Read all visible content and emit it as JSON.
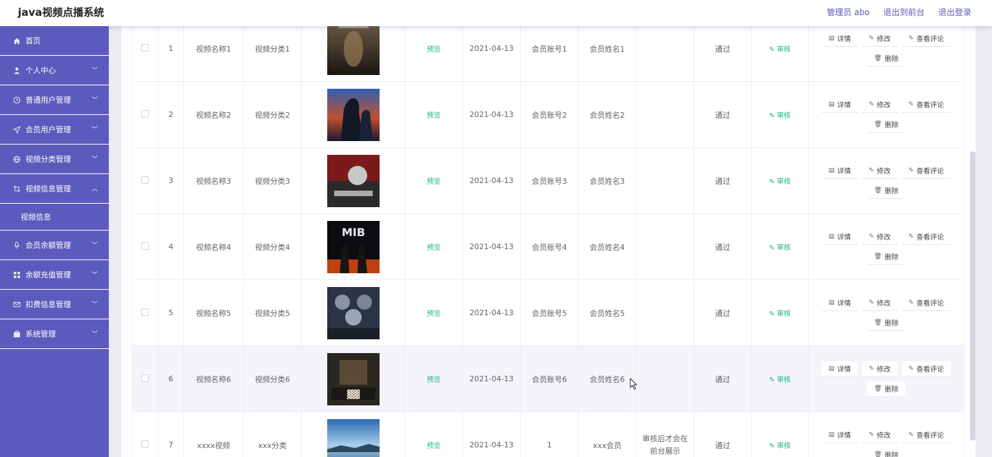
{
  "header": {
    "title": "java视频点播系统",
    "admin_label": "管理员 abo",
    "to_front_label": "退出到前台",
    "logout_label": "退出登录"
  },
  "sidebar": {
    "items": [
      {
        "label": "首页",
        "icon": "home-icon",
        "expandable": false
      },
      {
        "label": "个人中心",
        "icon": "user-icon",
        "expandable": true
      },
      {
        "label": "普通用户管理",
        "icon": "clock-icon",
        "expandable": true
      },
      {
        "label": "会员用户管理",
        "icon": "send-icon",
        "expandable": true
      },
      {
        "label": "视频分类管理",
        "icon": "globe-icon",
        "expandable": true
      },
      {
        "label": "视频信息管理",
        "icon": "crop-icon",
        "expandable": true,
        "expanded": true,
        "children": [
          "视频信息"
        ]
      },
      {
        "label": "会员余额管理",
        "icon": "mic-icon",
        "expandable": true
      },
      {
        "label": "余额充值管理",
        "icon": "grid-icon",
        "expandable": true
      },
      {
        "label": "扣费信息管理",
        "icon": "mail-icon",
        "expandable": true
      },
      {
        "label": "系统管理",
        "icon": "briefcase-icon",
        "expandable": true
      }
    ]
  },
  "table": {
    "preview_label": "预览",
    "audit_label": "审核",
    "actions": {
      "detail": "详情",
      "edit": "修改",
      "comments": "查看评论",
      "delete": "删除"
    },
    "rows": [
      {
        "index": "1",
        "name": "视频名称1",
        "category": "视频分类1",
        "date": "2021-04-13",
        "account": "会员账号1",
        "member_name": "会员姓名1",
        "reply": "",
        "status": "通过",
        "poster": "poster-titanic"
      },
      {
        "index": "2",
        "name": "视频名称2",
        "category": "视频分类2",
        "date": "2021-04-13",
        "account": "会员账号2",
        "member_name": "会员姓名2",
        "reply": "",
        "status": "通过",
        "poster": "poster-silhouette"
      },
      {
        "index": "3",
        "name": "视频名称3",
        "category": "视频分类3",
        "date": "2021-04-13",
        "account": "会员账号3",
        "member_name": "会员姓名3",
        "reply": "",
        "status": "通过",
        "poster": "poster-red"
      },
      {
        "index": "4",
        "name": "视频名称4",
        "category": "视频分类4",
        "date": "2021-04-13",
        "account": "会员账号4",
        "member_name": "会员姓名4",
        "reply": "",
        "status": "通过",
        "poster": "poster-mib"
      },
      {
        "index": "5",
        "name": "视频名称5",
        "category": "视频分类5",
        "date": "2021-04-13",
        "account": "会员账号5",
        "member_name": "会员姓名5",
        "reply": "",
        "status": "通过",
        "poster": "poster-blue"
      },
      {
        "index": "6",
        "name": "视频名称6",
        "category": "视频分类6",
        "date": "2021-04-13",
        "account": "会员账号6",
        "member_name": "会员姓名6",
        "reply": "",
        "status": "通过",
        "poster": "poster-war"
      },
      {
        "index": "7",
        "name": "xxxx视频",
        "category": "xxx分类",
        "date": "2021-04-13",
        "account": "1",
        "member_name": "xxx会员",
        "reply": "审核后才会在前台展示",
        "status": "通过",
        "poster": "poster-sky"
      }
    ]
  },
  "colors": {
    "sidebar_bg": "#5b5bbd",
    "accent": "#5b5bbd",
    "link_green": "#18b47d"
  }
}
